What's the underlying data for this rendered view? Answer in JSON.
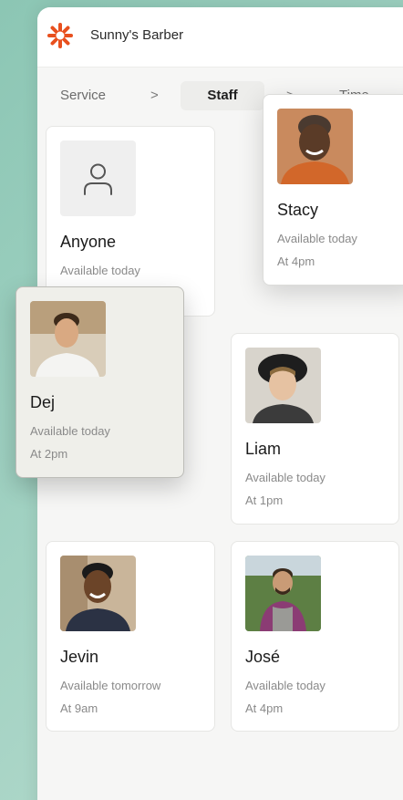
{
  "header": {
    "brand": "Sunny's Barber",
    "logo_icon": "sun-icon",
    "accent_color": "#e8501e"
  },
  "breadcrumb": {
    "step1": "Service",
    "sep": ">",
    "step2": "Staff",
    "step3": "Time"
  },
  "staff": [
    {
      "name": "Anyone",
      "availability": "Available today",
      "time": ""
    },
    {
      "name": "Stacy",
      "availability": "Available today",
      "time": "At 4pm"
    },
    {
      "name": "Dej",
      "availability": "Available today",
      "time": "At 2pm"
    },
    {
      "name": "Liam",
      "availability": "Available today",
      "time": "At 1pm"
    },
    {
      "name": "Jevin",
      "availability": "Available tomorrow",
      "time": "At 9am"
    },
    {
      "name": "José",
      "availability": "Available today",
      "time": "At 4pm"
    }
  ]
}
